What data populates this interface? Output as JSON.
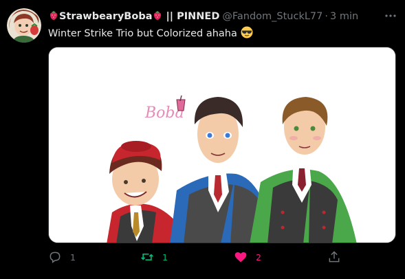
{
  "tweet": {
    "display_name": "StrawbearyBoba",
    "pinned_label": "|| PINNED",
    "handle": "@Fandom_StuckL77",
    "separator": "·",
    "time": "3 min",
    "text": "Winter Strike Trio but Colorized ahaha",
    "media_watermark": "Boba"
  },
  "actions": {
    "reply_count": "1",
    "retweet_count": "1",
    "like_count": "2"
  },
  "colors": {
    "background": "#000000",
    "text": "#e7e9ea",
    "muted": "#71767b",
    "retweet": "#00ba7c",
    "like": "#f91880"
  },
  "icons": [
    "avatar",
    "strawberry-icon",
    "more-icon",
    "sunglasses-emoji-icon",
    "reply-icon",
    "retweet-icon",
    "heart-icon",
    "share-icon"
  ]
}
